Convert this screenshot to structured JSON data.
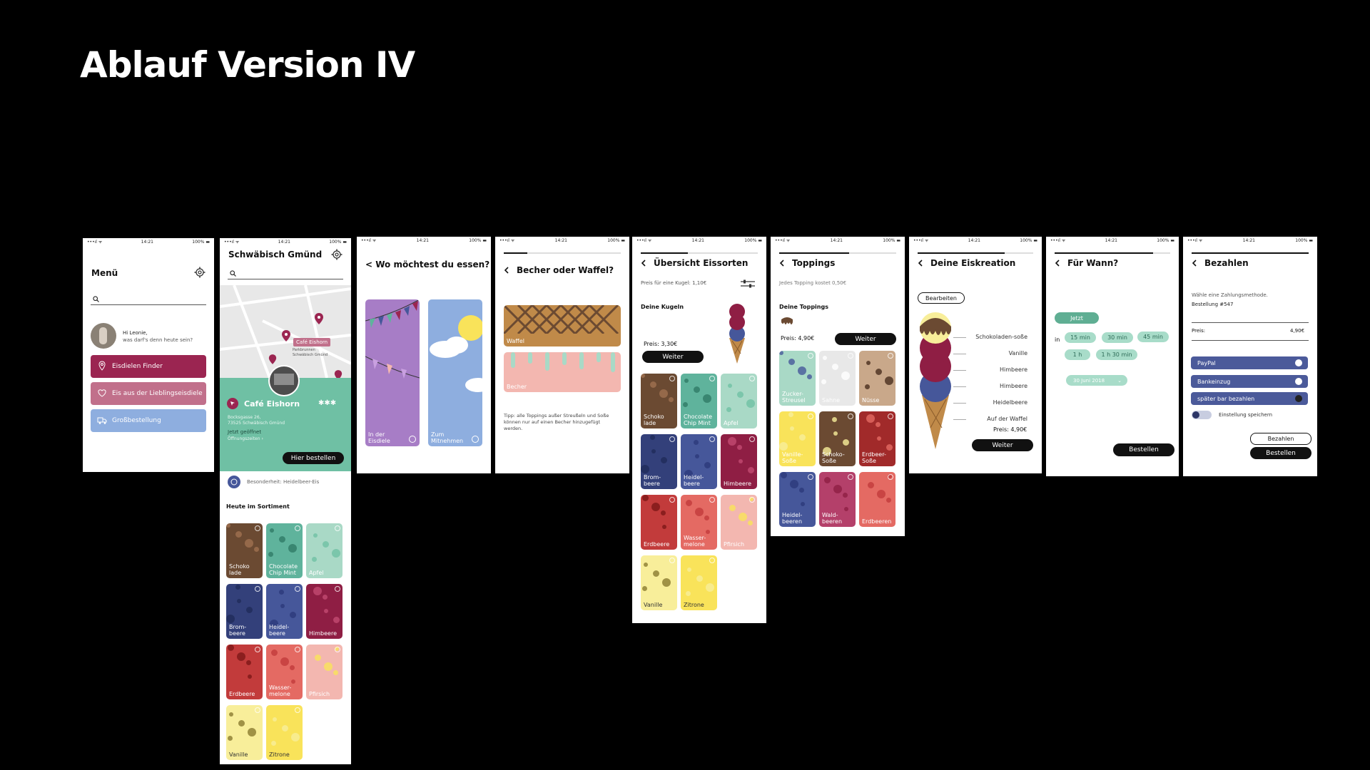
{
  "page_title": "Ablauf Version IV",
  "status_bar": {
    "carrier": "•••ıl ᯤ",
    "time": "14:21",
    "battery": "100% ▬"
  },
  "s1": {
    "title": "Menü",
    "greeting_name": "Hi Leonie,",
    "greeting_q": "was darf's denn heute sein?",
    "btn1": "Eisdielen Finder",
    "btn2": "Eis aus der Lieblingseisdiele",
    "btn3": "Großbestellung"
  },
  "s2": {
    "title": "Schwäbisch Gmünd",
    "map_pin": "Café Eishorn",
    "map_street1": "Parkbrunnen",
    "map_street2": "Schwäbisch Gmünd",
    "cafe": "Café Eishorn",
    "stars": "✱✱✱",
    "addr1": "Bocksgasse 26,",
    "addr2": "73525 Schwäbisch Gmünd",
    "open": "Jetzt geöffnet",
    "hours": "Öffnungszeiten ›",
    "order_btn": "Hier bestellen",
    "special": "Besonderheit: Heidelbeer-Eis",
    "today": "Heute im Sortiment"
  },
  "s3": {
    "title": "< Wo möchtest du essen?",
    "opt1": "In der Eisdiele",
    "opt2": "Zum Mitnehmen"
  },
  "s4": {
    "title": "Becher oder Waffel?",
    "opt1": "Waffel",
    "opt2": "Becher",
    "tip": "Tipp: alle Toppings außer Streußeln und Soße können nur auf einen Becher hinzugefügt werden."
  },
  "s5": {
    "title": "Übersicht Eissorten",
    "price_per": "Preis für eine Kugel: 1,10€",
    "kugeln": "Deine Kugeln",
    "price": "Preis: 3,30€",
    "btn": "Weiter"
  },
  "s6": {
    "title": "Toppings",
    "price_per": "Jedes Topping kostet 0,50€",
    "toppings": "Deine Toppings",
    "price": "Preis: 4,90€",
    "btn": "Weiter",
    "tiles": [
      "Zucker-Streusel",
      "Sahne",
      "Nüsse",
      "Vanille-Soße",
      "Schoko-Soße",
      "Erdbeer-Soße",
      "Heidel-beeren",
      "Wald-beeren",
      "Erdbeeren"
    ]
  },
  "s7": {
    "title": "Deine Eiskreation",
    "edit": "Bearbeiten",
    "items": [
      "Schokoladen-soße",
      "Vanille",
      "Himbeere",
      "Himbeere",
      "Heidelbeere",
      "Auf der Waffel"
    ],
    "price": "Preis: 4,90€",
    "btn": "Weiter"
  },
  "s8": {
    "title": "Für Wann?",
    "now": "Jetzt",
    "in": "in",
    "times": [
      "15 min",
      "30 min",
      "45 min",
      "1 h",
      "1 h 30 min"
    ],
    "date": "30 Juni 2018",
    "btn": "Bestellen"
  },
  "s9": {
    "title": "Bezahlen",
    "choose": "Wähle eine Zahlungsmethode.",
    "order": "Bestellung #547",
    "price_label": "Preis:",
    "price": "4,90€",
    "methods": [
      "PayPal",
      "Bankeinzug",
      "später bar bezahlen"
    ],
    "save": "Einstellung speichern",
    "pay_btn": "Bezahlen",
    "order_btn": "Bestellen"
  },
  "flavors": [
    "Schoko lade",
    "Chocolate Chip Mint",
    "Apfel",
    "Brom- beere",
    "Heidel- beere",
    "Himbeere",
    "Erdbeere",
    "Wasser- melone",
    "Pfirsich",
    "Vanille",
    "Zitrone"
  ],
  "colors": {
    "schoko": "#6b4a32",
    "mint": "#5fb39c",
    "apfel": "#a9d9c6",
    "brom": "#33407a",
    "heidel": "#46579a",
    "himbeere": "#8f1e44",
    "erdbeere": "#c23b3b",
    "wasser": "#e46a63",
    "pfirsich": "#f3b7b0",
    "vanille": "#f8ee9a",
    "zitrone": "#f9e35a",
    "brand": "#9b2551",
    "teal": "#6fc0a4"
  }
}
